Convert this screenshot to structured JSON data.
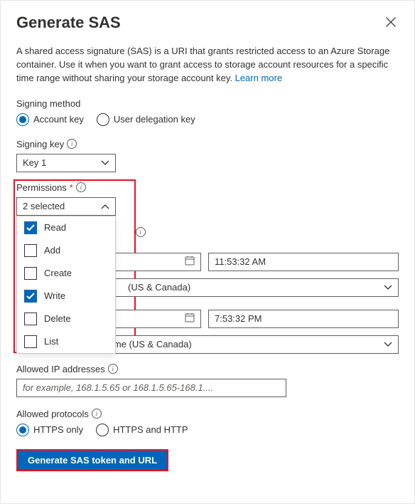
{
  "header": {
    "title": "Generate SAS",
    "close_label": "Close"
  },
  "description": {
    "text": "A shared access signature (SAS) is a URI that grants restricted access to an Azure Storage container. Use it when you want to grant access to storage account resources for a specific time range without sharing your storage account key. ",
    "link_text": "Learn more"
  },
  "signing_method": {
    "label": "Signing method",
    "options": [
      {
        "label": "Account key",
        "selected": true
      },
      {
        "label": "User delegation key",
        "selected": false
      }
    ]
  },
  "signing_key": {
    "label": "Signing key",
    "selected": "Key 1"
  },
  "permissions": {
    "label": "Permissions",
    "required": true,
    "selected_text": "2 selected",
    "options": [
      {
        "label": "Read",
        "checked": true
      },
      {
        "label": "Add",
        "checked": false
      },
      {
        "label": "Create",
        "checked": false
      },
      {
        "label": "Write",
        "checked": true
      },
      {
        "label": "Delete",
        "checked": false
      },
      {
        "label": "List",
        "checked": false
      }
    ]
  },
  "start": {
    "time": "11:53:32 AM",
    "timezone": "(US & Canada)"
  },
  "expiry": {
    "time": "7:53:32 PM",
    "timezone_full": "(UTC-08:00) Pacific Time (US & Canada)"
  },
  "allowed_ip": {
    "label": "Allowed IP addresses",
    "placeholder": "for example, 168.1.5.65 or 168.1.5.65-168.1...."
  },
  "allowed_protocols": {
    "label": "Allowed protocols",
    "options": [
      {
        "label": "HTTPS only",
        "selected": true
      },
      {
        "label": "HTTPS and HTTP",
        "selected": false
      }
    ]
  },
  "generate_button": "Generate SAS token and URL"
}
